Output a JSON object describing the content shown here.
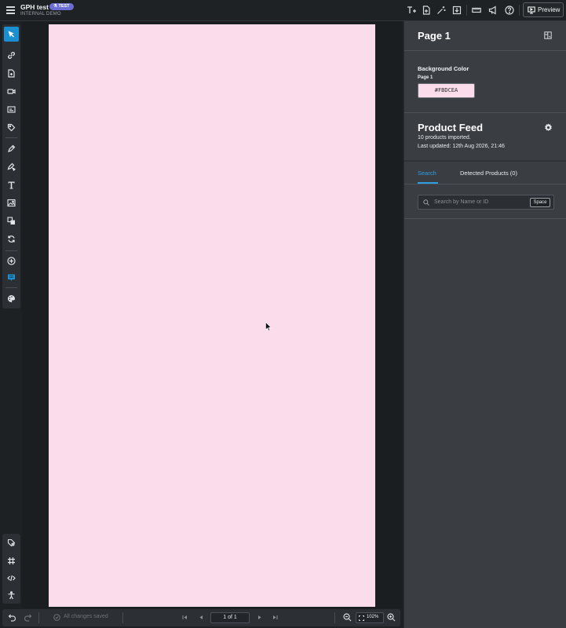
{
  "header": {
    "title": "GPH test",
    "badge": "⚗ TEST",
    "subtitle": "INTERNAL DEMO",
    "preview_label": "Preview"
  },
  "left_toolbar": {
    "tools": [
      "select-icon",
      "link-icon",
      "page-add-icon",
      "video-icon",
      "caption-icon",
      "tag-icon",
      "hotspot-icon",
      "hotspot-edit-icon",
      "text-icon",
      "image-icon",
      "layers-icon",
      "sync-icon",
      "add-circle-icon",
      "book-icon",
      "palette-icon"
    ],
    "bottom_tools": [
      "tag-search-icon",
      "grid-icon",
      "code-icon",
      "accessibility-icon"
    ]
  },
  "canvas": {
    "page_color": "#FBDCEA"
  },
  "bottom_bar": {
    "save_status": "All changes saved",
    "page_indicator": "1 of 1",
    "zoom": "102%"
  },
  "right_panel": {
    "page_title": "Page 1",
    "background_label": "Background Color",
    "background_sub": "Page 1",
    "background_value": "#FBDCEA",
    "product_feed_title": "Product Feed",
    "products_imported": "10 products imported.",
    "last_updated": "Last updated: 12th Aug 2026, 21:46",
    "tabs": [
      {
        "label": "Search",
        "active": true
      },
      {
        "label": "Detected Products (0)",
        "active": false
      }
    ],
    "search_placeholder": "Search by Name or ID",
    "search_shortcut": "Space"
  },
  "colors": {
    "accent": "#1a8fd1",
    "panel": "#3a3e43",
    "page": "#FBDCEA"
  }
}
